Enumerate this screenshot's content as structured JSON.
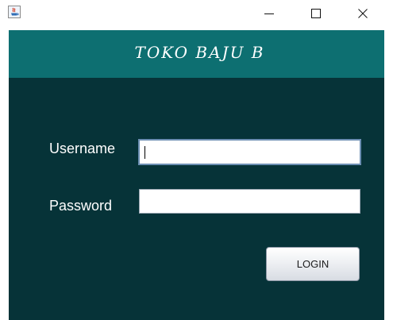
{
  "window": {
    "icon": "java-icon",
    "controls": {
      "minimize_icon": "minimize-icon",
      "maximize_icon": "maximize-icon",
      "close_icon": "close-icon"
    }
  },
  "header": {
    "title": "TOKO BAJU B"
  },
  "form": {
    "username_label": "Username",
    "username_value": "",
    "password_label": "Password",
    "password_value": "",
    "login_label": "LOGIN"
  },
  "colors": {
    "header_bg": "#0d6f71",
    "panel_bg": "#063338",
    "text": "#ffffff"
  }
}
